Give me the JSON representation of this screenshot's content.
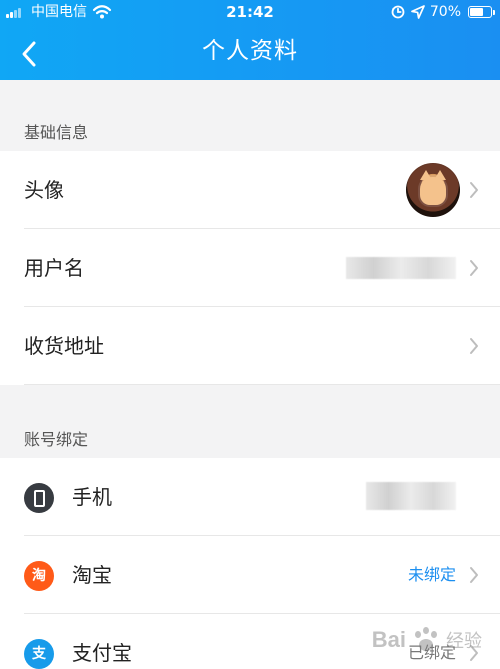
{
  "status_bar": {
    "carrier": "中国电信",
    "time": "21:42",
    "battery": "70%",
    "battery_level": 0.7,
    "icons": [
      "signal-icon",
      "wifi-icon",
      "screen-lock-icon",
      "location-icon",
      "battery-icon"
    ]
  },
  "header": {
    "title": "个人资料",
    "back_icon": "chevron-left-icon",
    "gradient": [
      "#10a7f5",
      "#1a8ff2"
    ]
  },
  "sections": {
    "basic": {
      "title": "基础信息",
      "rows": {
        "avatar": "头像",
        "username": "用户名",
        "address": "收货地址"
      }
    },
    "accounts": {
      "title": "账号绑定",
      "rows": {
        "phone": "手机",
        "taobao": "淘宝",
        "taobao_icon_text": "淘",
        "taobao_status": "未绑定",
        "alipay": "支付宝",
        "alipay_icon_text": "支",
        "alipay_status": "已绑定"
      }
    }
  },
  "icons": {
    "chevron": "chevron-right-icon",
    "phone": "phone-icon",
    "taobao": "taobao-icon",
    "alipay": "alipay-icon",
    "avatar": "cat-avatar-image"
  },
  "watermark": {
    "brand": "Bai",
    "brand_cn": "经验"
  },
  "colors": {
    "accent": "#1c8ff0",
    "taobao": "#ff5a18",
    "alipay": "#179bea",
    "phone": "#373b41"
  }
}
